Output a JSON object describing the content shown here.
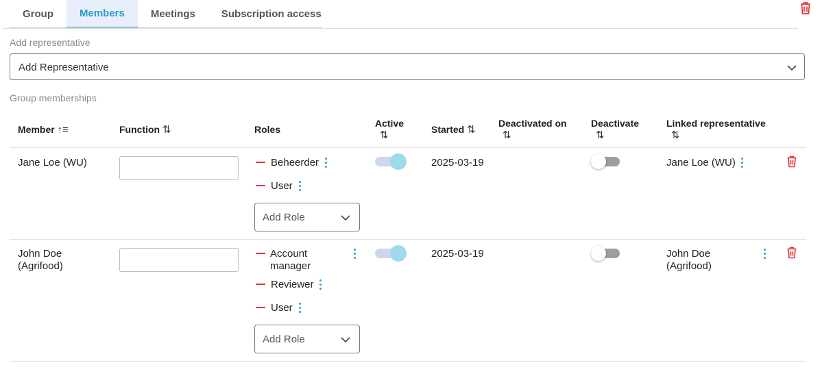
{
  "tabs": [
    {
      "label": "Group"
    },
    {
      "label": "Members"
    },
    {
      "label": "Meetings"
    },
    {
      "label": "Subscription access"
    }
  ],
  "active_tab": "Members",
  "add_representative": {
    "section_label": "Add representative",
    "select_value": "Add Representative"
  },
  "memberships": {
    "section_label": "Group memberships",
    "columns": {
      "member": "Member",
      "function": "Function",
      "roles": "Roles",
      "active": "Active",
      "started": "Started",
      "deactivated_on": "Deactivated on",
      "deactivate": "Deactivate",
      "linked_representative": "Linked representative"
    },
    "sort_glyph": "⇅",
    "sort_active_glyph": "↑≡",
    "rows": [
      {
        "member": "Jane Loe (WU)",
        "function": "",
        "roles": [
          "Beheerder",
          "User"
        ],
        "add_role": "Add Role",
        "active": true,
        "started": "2025-03-19",
        "deactivated_on": "",
        "deactivate": false,
        "linked_representative": "Jane Loe (WU)"
      },
      {
        "member_line1": "John Doe",
        "member_line2": "(Agrifood)",
        "function": "",
        "role1_line1": "Account",
        "role1_line2": "manager",
        "role2": "Reviewer",
        "role3": "User",
        "add_role": "Add Role",
        "active": true,
        "started": "2025-03-19",
        "deactivated_on": "",
        "deactivate": false,
        "linked_line1": "John Doe",
        "linked_line2": "(Agrifood)"
      }
    ]
  },
  "colors": {
    "accent": "#2a9ec8",
    "danger": "#e4333d",
    "active_tab_bg": "#e8eefa"
  },
  "icons": {
    "delete": "trash-icon",
    "more": "kebab-menu-icon",
    "dropdown": "chevron-down-icon",
    "remove_role": "minus-icon",
    "sort": "sort-icon"
  }
}
